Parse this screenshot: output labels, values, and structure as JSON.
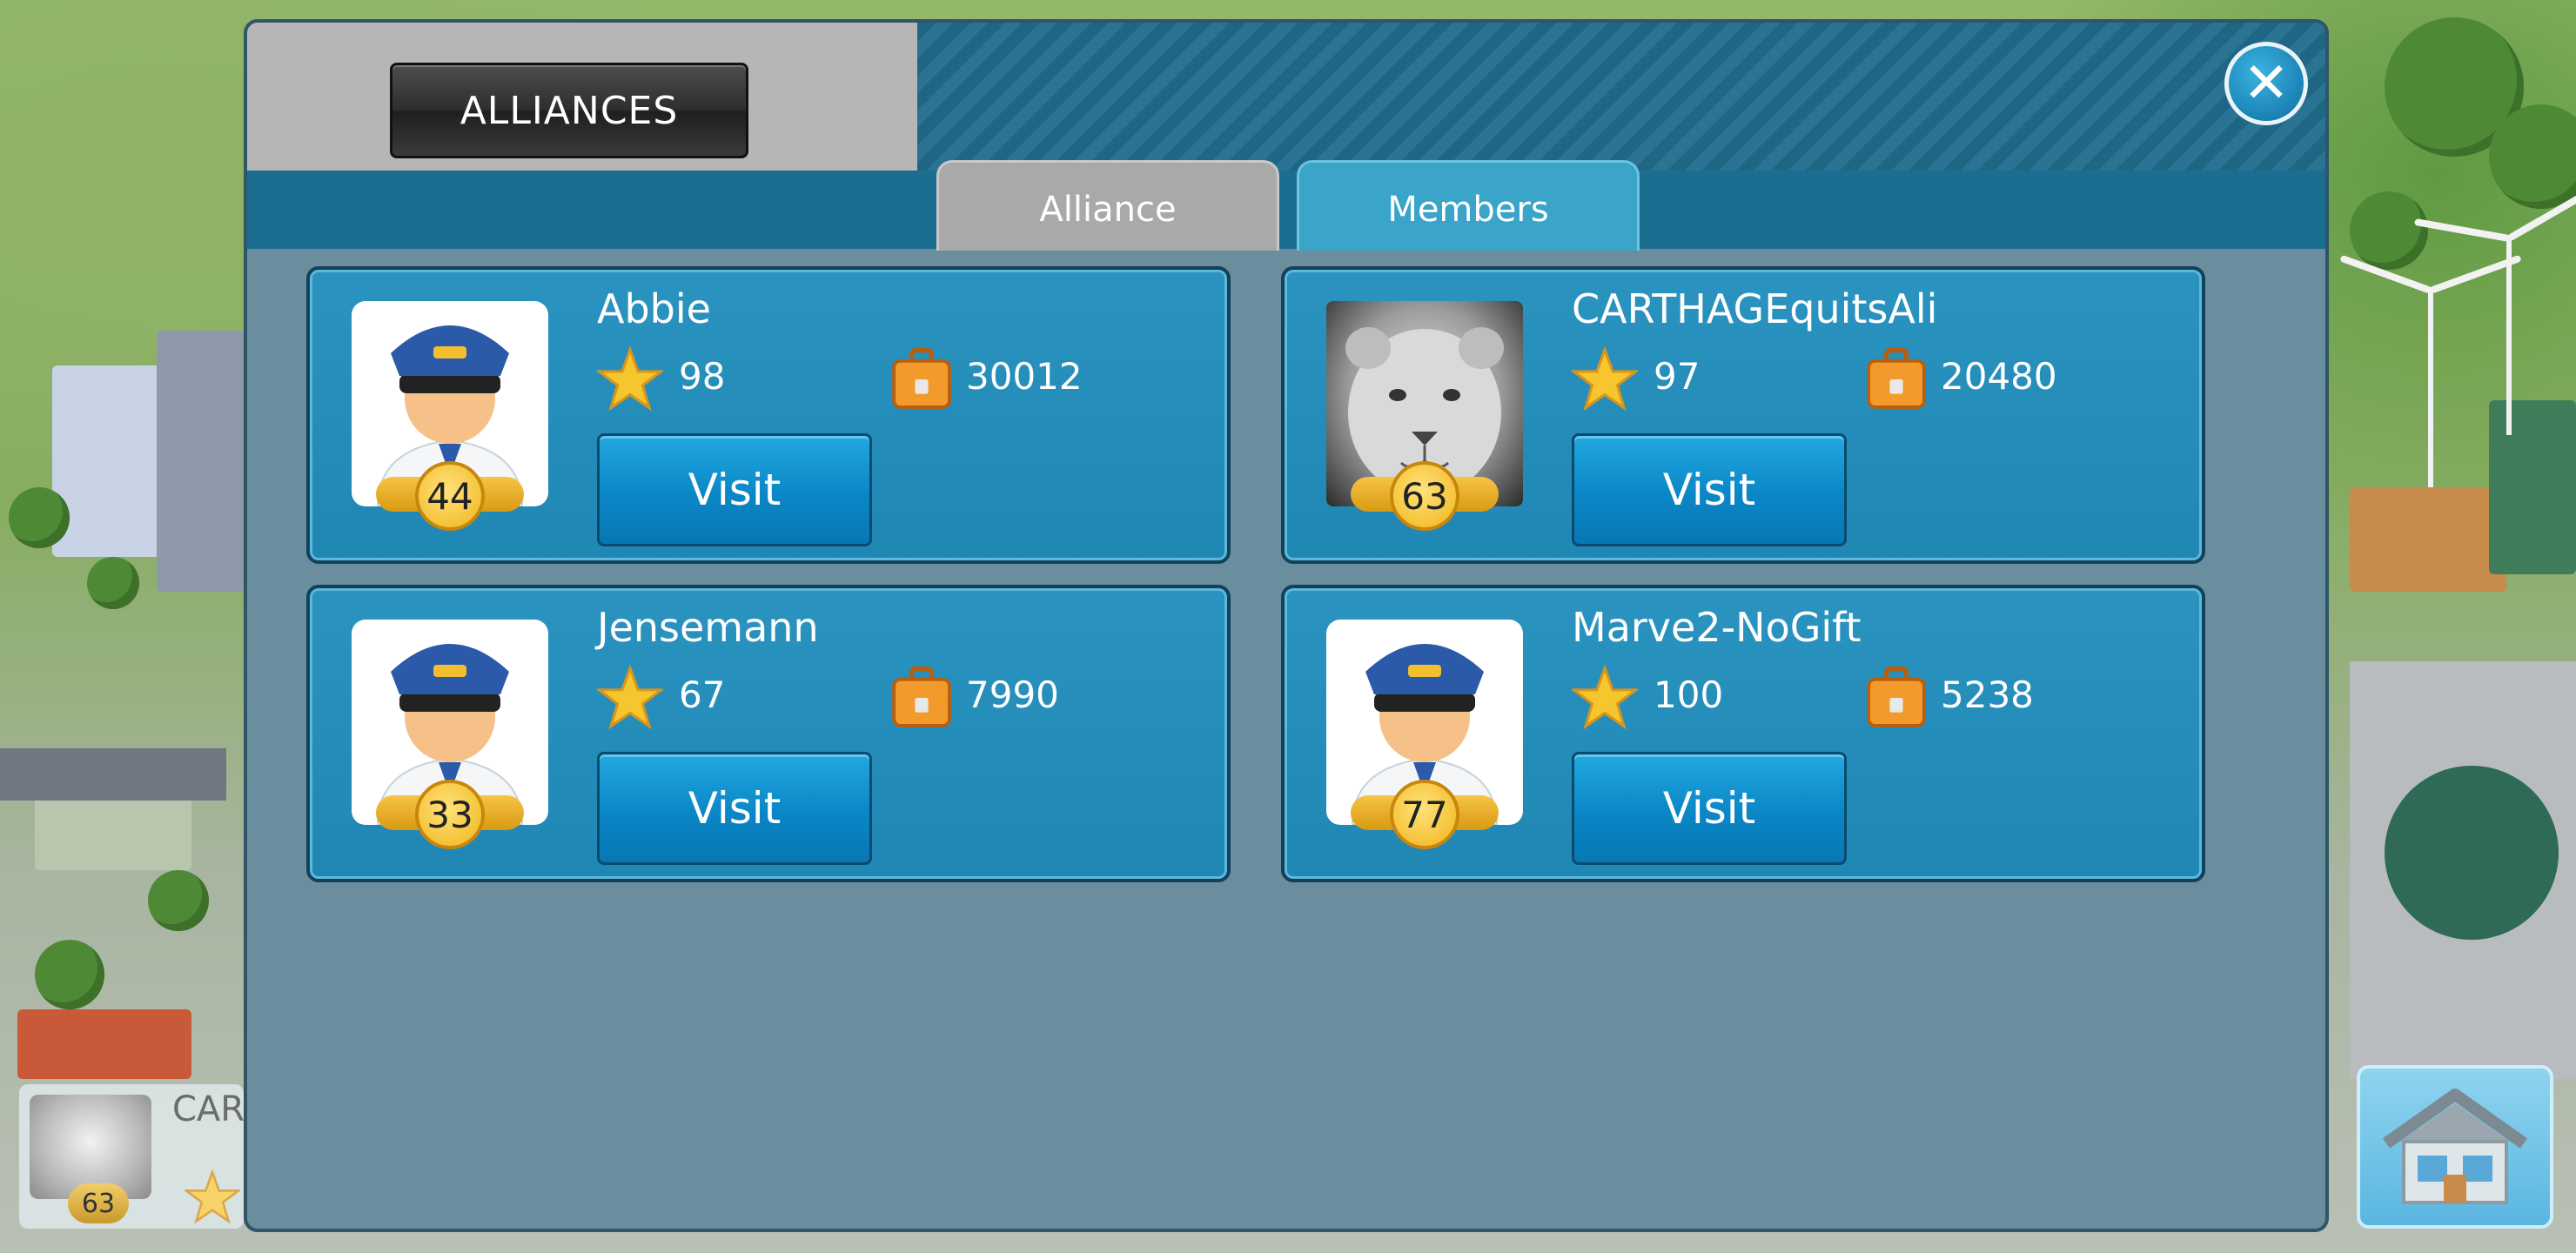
{
  "dialog": {
    "title": "ALLIANCES",
    "tabs": [
      {
        "label": "Alliance",
        "active": false
      },
      {
        "label": "Members",
        "active": true
      }
    ]
  },
  "members": [
    {
      "name": "Abbie",
      "stars": "98",
      "bags": "30012",
      "level": "44",
      "avatar": "pilot-avatar",
      "visit_label": "Visit"
    },
    {
      "name": "CARTHAGEquitsAli",
      "stars": "97",
      "bags": "20480",
      "level": "63",
      "avatar": "lion-cub-photo",
      "visit_label": "Visit"
    },
    {
      "name": "Jensemann",
      "stars": "67",
      "bags": "7990",
      "level": "33",
      "avatar": "pilot-avatar",
      "visit_label": "Visit"
    },
    {
      "name": "Marve2-NoGift",
      "stars": "100",
      "bags": "5238",
      "level": "77",
      "avatar": "pilot-avatar",
      "visit_label": "Visit"
    }
  ],
  "player": {
    "name_fragment": "CAR",
    "level": "63"
  },
  "icons": {
    "close": "close-icon",
    "star": "star-icon",
    "bag": "suitcase-icon",
    "home": "home-icon"
  },
  "colors": {
    "card": "#2087b4",
    "visit_button": "#0a86c6",
    "tab_active": "#3aa4c9",
    "tab_inactive": "#a9a9a9",
    "panel": "#6a8e9e"
  }
}
